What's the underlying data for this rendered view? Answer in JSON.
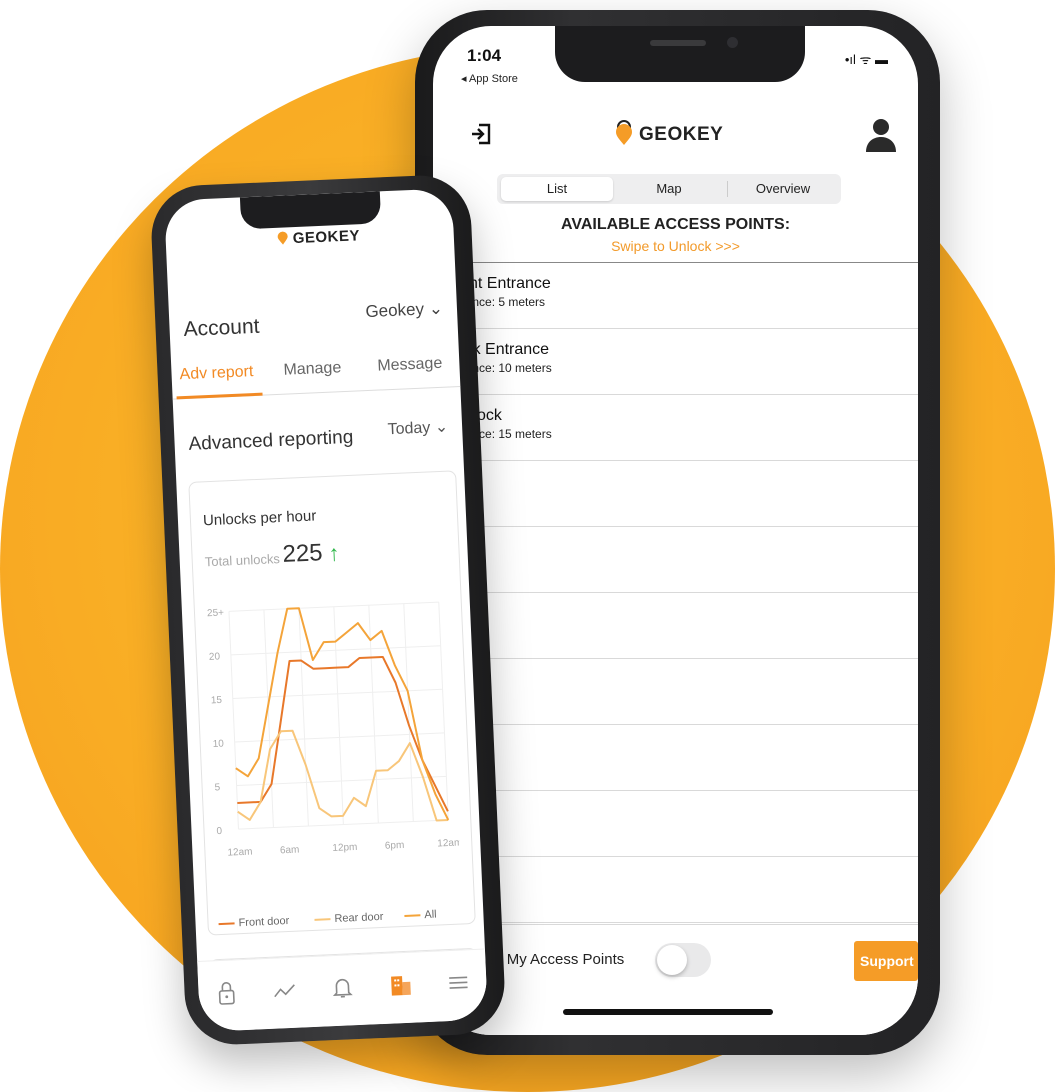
{
  "colors": {
    "accent": "#f28a24",
    "background_circle": "#fbb52a",
    "support_button": "#f59c27",
    "trend_up": "#2fb74a",
    "series_front": "#e8782a",
    "series_rear": "#f8c67a",
    "series_all": "#f4a43a"
  },
  "front_phone": {
    "logo": "GEOKEY",
    "account_label": "Account",
    "account_selector": "Geokey ⌄",
    "tabs": [
      {
        "label": "Adv report",
        "active": true
      },
      {
        "label": "Manage",
        "active": false
      },
      {
        "label": "Message",
        "active": false
      }
    ],
    "section_title": "Advanced reporting",
    "range_selector": "Today ⌄",
    "card": {
      "title": "Unlocks per hour",
      "total_label": "Total unlocks",
      "total_value": "225",
      "trend_arrow": "↑"
    },
    "nav_icons": [
      "lock-icon",
      "chart-icon",
      "bell-icon",
      "building-icon",
      "menu-icon"
    ]
  },
  "chart_data": {
    "type": "line",
    "title": "Unlocks per hour",
    "x": [
      "12am",
      "6am",
      "12pm",
      "6pm",
      "12am"
    ],
    "y_ticks": [
      "0",
      "5",
      "10",
      "15",
      "20",
      "25+"
    ],
    "ylim": [
      0,
      25
    ],
    "grid": true,
    "legend_position": "bottom",
    "series": [
      {
        "name": "Front door",
        "points": [
          [
            0,
            3
          ],
          [
            2,
            3
          ],
          [
            3,
            5
          ],
          [
            4,
            12
          ],
          [
            5,
            19
          ],
          [
            6,
            19
          ],
          [
            7,
            18
          ],
          [
            8,
            18
          ],
          [
            9,
            18
          ],
          [
            10,
            18
          ],
          [
            11,
            19
          ],
          [
            12,
            19
          ],
          [
            13,
            19
          ],
          [
            14,
            16
          ],
          [
            15,
            11
          ],
          [
            16,
            7
          ],
          [
            17,
            4
          ],
          [
            18,
            1
          ]
        ]
      },
      {
        "name": "Rear door",
        "points": [
          [
            0,
            2
          ],
          [
            1,
            1
          ],
          [
            2,
            3
          ],
          [
            3,
            9
          ],
          [
            4,
            11
          ],
          [
            5,
            11
          ],
          [
            6,
            7
          ],
          [
            7,
            2
          ],
          [
            8,
            1
          ],
          [
            9,
            1
          ],
          [
            10,
            3
          ],
          [
            11,
            2
          ],
          [
            12,
            6
          ],
          [
            13,
            6
          ],
          [
            14,
            7
          ],
          [
            15,
            9
          ],
          [
            16,
            5
          ],
          [
            17,
            0
          ],
          [
            18,
            0
          ]
        ]
      },
      {
        "name": "All",
        "points": [
          [
            0,
            7
          ],
          [
            1,
            6
          ],
          [
            2,
            8
          ],
          [
            3,
            14
          ],
          [
            4,
            20
          ],
          [
            5,
            25
          ],
          [
            6,
            25
          ],
          [
            7,
            19
          ],
          [
            8,
            21
          ],
          [
            9,
            21
          ],
          [
            10,
            22
          ],
          [
            11,
            23
          ],
          [
            12,
            21
          ],
          [
            13,
            22
          ],
          [
            14,
            18
          ],
          [
            15,
            15
          ],
          [
            16,
            7
          ],
          [
            17,
            3
          ],
          [
            18,
            0
          ]
        ]
      }
    ]
  },
  "back_phone": {
    "status_time": "1:04",
    "back_to_app": "◂ App Store",
    "status_icons": "•ıl ᯤ ▬",
    "logo": "GEOKEY",
    "segments": [
      {
        "label": "List",
        "active": true
      },
      {
        "label": "Map",
        "active": false
      },
      {
        "label": "Overview",
        "active": false
      }
    ],
    "title": "AVAILABLE ACCESS POINTS:",
    "subtitle": "Swipe to Unlock >>>",
    "access_points": [
      {
        "name": "Front Entrance",
        "distance": "Distance: 5 meters"
      },
      {
        "name": "Back Entrance",
        "distance": "Distance: 10 meters"
      },
      {
        "name": "Padlock",
        "distance": "Distance: 15 meters"
      }
    ],
    "show_all_label": "Show All My Access Points",
    "show_all_enabled": false,
    "support_label": "Support"
  }
}
